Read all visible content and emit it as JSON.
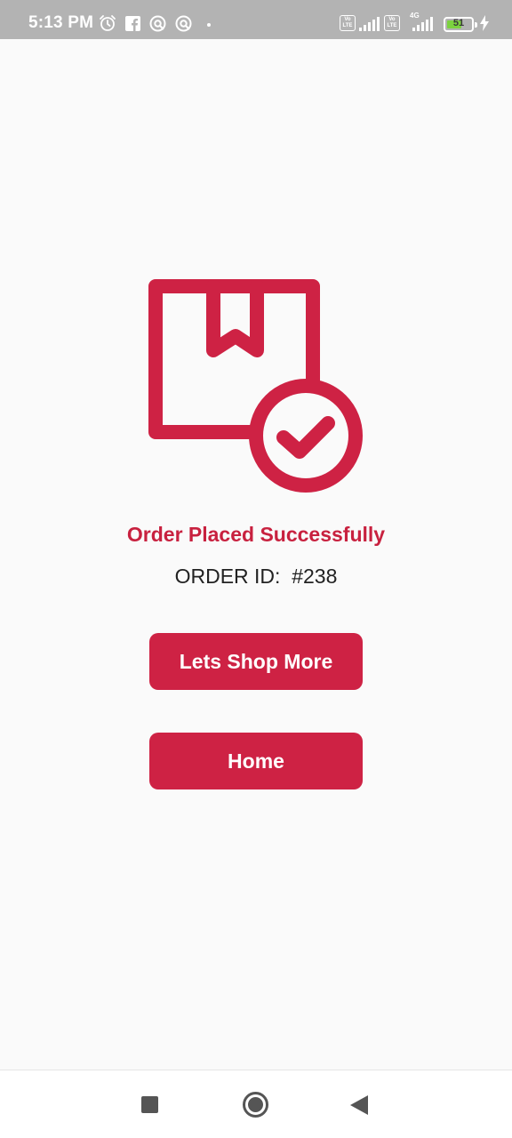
{
  "status_bar": {
    "time": "5:13 PM",
    "notification_icons": [
      "alarm-icon",
      "facebook-icon",
      "app-notification-icon",
      "app-notification-icon"
    ],
    "sim1": {
      "label": "Vo LTE"
    },
    "sim2": {
      "label": "Vo LTE",
      "network": "4G"
    },
    "battery_level": "51",
    "charging": true
  },
  "order": {
    "icon": "package-check-icon",
    "accent_color": "#ce2244",
    "title": "Order Placed Successfully",
    "order_id_text": "ORDER ID:  #238"
  },
  "buttons": {
    "shop_more_label": "Lets Shop More",
    "home_label": "Home"
  },
  "nav_bar": {
    "icons": [
      "recents-icon",
      "home-icon",
      "back-icon"
    ]
  }
}
